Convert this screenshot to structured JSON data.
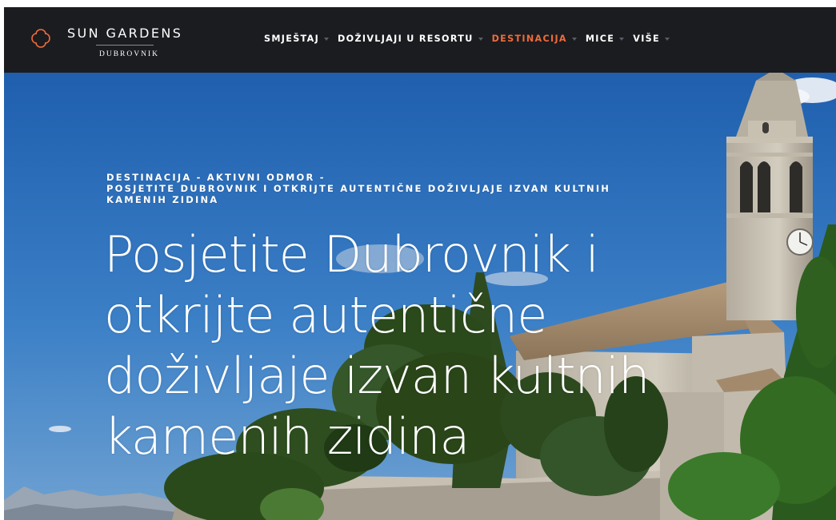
{
  "brand": {
    "name": "SUN GARDENS",
    "sub": "DUBROVNIK",
    "accent": "#ee6b3a"
  },
  "nav": {
    "items": [
      {
        "label": "SMJEŠTAJ",
        "active": false
      },
      {
        "label": "DOŽIVLJAJI U RESORTU",
        "active": false
      },
      {
        "label": "DESTINACIJA",
        "active": true
      },
      {
        "label": "MICE",
        "active": false
      },
      {
        "label": "VIŠE",
        "active": false
      }
    ],
    "caret_icon": "chevron-down-icon"
  },
  "hero": {
    "breadcrumb": {
      "line1": "DESTINACIJA - AKTIVNI ODMOR -",
      "line2": "POSJETITE DUBROVNIK I OTKRIJTE AUTENTIČNE DOŽIVLJAJE IZVAN KULTNIH",
      "line3": "KAMENIH ZIDINA"
    },
    "title": {
      "line1": "Posjetite Dubrovnik i",
      "line2": "otkrijte autentične",
      "line3": "doživljaje izvan kultnih",
      "line4": "kamenih zidina"
    },
    "background": "bell-tower-church-photo"
  },
  "colors": {
    "header_bg": "#1b1c20",
    "sky": "#2f6fb8",
    "text": "#ffffff"
  }
}
